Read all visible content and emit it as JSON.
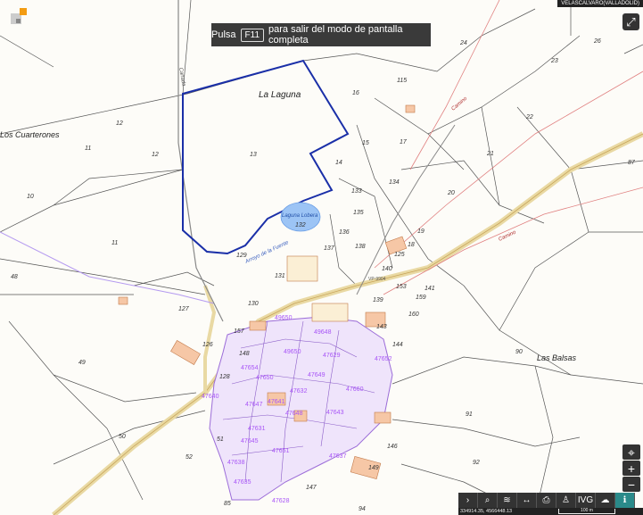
{
  "banner": {
    "pre": "Pulsa",
    "key": "F11",
    "post": "para salir del modo de pantalla completa"
  },
  "region_label": "VELASCALVARO(VALLADOLID)",
  "coords": "334914.35, 4566448.13",
  "scale": "100 m",
  "colors": {
    "boundary": "#1a2fa8",
    "road": "#d9c07a",
    "urban": "#e8d8f5",
    "parcel_line": "#3b3b3b",
    "label_purple": "#a855f7",
    "lagoon": "#9cc4f5"
  },
  "place_labels": [
    {
      "id": "la-laguna",
      "text": "La Laguna"
    },
    {
      "id": "los-cuarterones",
      "text": "Los Cuarterones"
    },
    {
      "id": "las-balsas",
      "text": "Las Balsas"
    },
    {
      "id": "laguna-lobera",
      "text": "Laguna Lobera"
    }
  ],
  "parcels": [
    "12",
    "11",
    "13",
    "16",
    "115",
    "15",
    "17",
    "14",
    "134",
    "133",
    "135",
    "136",
    "137",
    "138",
    "132",
    "131",
    "129",
    "130",
    "127",
    "126",
    "128",
    "148",
    "157",
    "143",
    "144",
    "140",
    "139",
    "125",
    "18",
    "19",
    "20",
    "21",
    "22",
    "23",
    "24",
    "26",
    "87",
    "90",
    "91",
    "92",
    "94",
    "146",
    "147",
    "149",
    "141",
    "159",
    "160",
    "153",
    "49",
    "50",
    "51",
    "52",
    "48",
    "10",
    "85"
  ],
  "urban_refs": [
    "49650",
    "49650",
    "49648",
    "47654",
    "47650",
    "47652",
    "47660",
    "47640",
    "47641",
    "47643",
    "47647",
    "47648",
    "47649",
    "47645",
    "47651",
    "47638",
    "47637",
    "47635",
    "47628",
    "47631",
    "47632",
    "47629"
  ],
  "roads": [
    "Camino",
    "Camino",
    "Arroyo de la Fuente",
    "VP-9904",
    "Cañada"
  ],
  "toolbar": [
    "next-icon",
    "search-icon",
    "layers-icon",
    "measure-icon",
    "print-icon",
    "street-icon",
    "ivg-label",
    "cloud-icon",
    "info-icon"
  ],
  "toolbar_labels": {
    "ivg": "IVG"
  }
}
